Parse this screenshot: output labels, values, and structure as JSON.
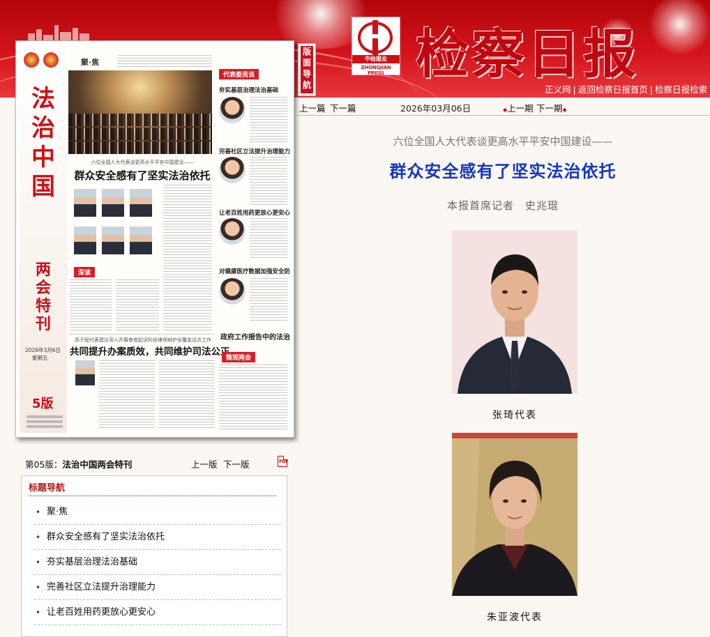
{
  "header": {
    "logo_tag": "中检报业",
    "logo_en": "ZHONGJIAN PRESS",
    "masthead": "检察日报",
    "links": [
      "正义网",
      "返回检察日报首页",
      "检察日报检索"
    ]
  },
  "page_nav_tab": "版面导航",
  "page_thumb": {
    "vertical_title": "法治中国",
    "vertical_sub": "两会特刊",
    "date": "2026年3月6日",
    "weekday": "星期五",
    "edition": "5版",
    "section_focus": "聚·焦",
    "kicker_main": "六位全国人大代表谈更高水平平安中国建设——",
    "headline_main": "群众安全感有了坚实法治依托",
    "label_deep_read": "深读",
    "label_rep": "代表委员说",
    "kicker_second": "高子程代表建议深入开展审查起诉阶段律师辩护全覆盖试点工作",
    "headline_second": "共同提升办案质效，共同维护司法公正",
    "side_titles": [
      "夯实基层治理法治基础",
      "完善社区立法提升治理能力",
      "让老百姓用药更放心更安心",
      "对健康医疗数据加强安全防护",
      "政府工作报告中的法治细节"
    ],
    "label_watch": "微观两会"
  },
  "navbar": {
    "prev_article": "上一篇",
    "next_article": "下一篇",
    "date": "2026年03月06日",
    "prev_issue": "上一期",
    "next_issue": "下一期"
  },
  "article": {
    "subtitle": "六位全国人大代表谈更高水平平安中国建设——",
    "headline": "群众安全感有了坚实法治依托",
    "byline": "本报首席记者　史兆琨",
    "captions": [
      "张琦代表",
      "朱亚波代表"
    ]
  },
  "edition_row": {
    "label": "第05版：",
    "name": "法治中国两会特刊",
    "prev": "上一版",
    "next": "下一版",
    "pdf": "PDF"
  },
  "toc": {
    "title": "标题导航",
    "items": [
      "聚·焦",
      "群众安全感有了坚实法治依托",
      "夯实基层治理法治基础",
      "完善社区立法提升治理能力",
      "让老百姓用药更放心更安心"
    ]
  },
  "colors": {
    "brand_red": "#c8101a",
    "headline_blue": "#1236c6",
    "toc_title": "#b1151b"
  }
}
